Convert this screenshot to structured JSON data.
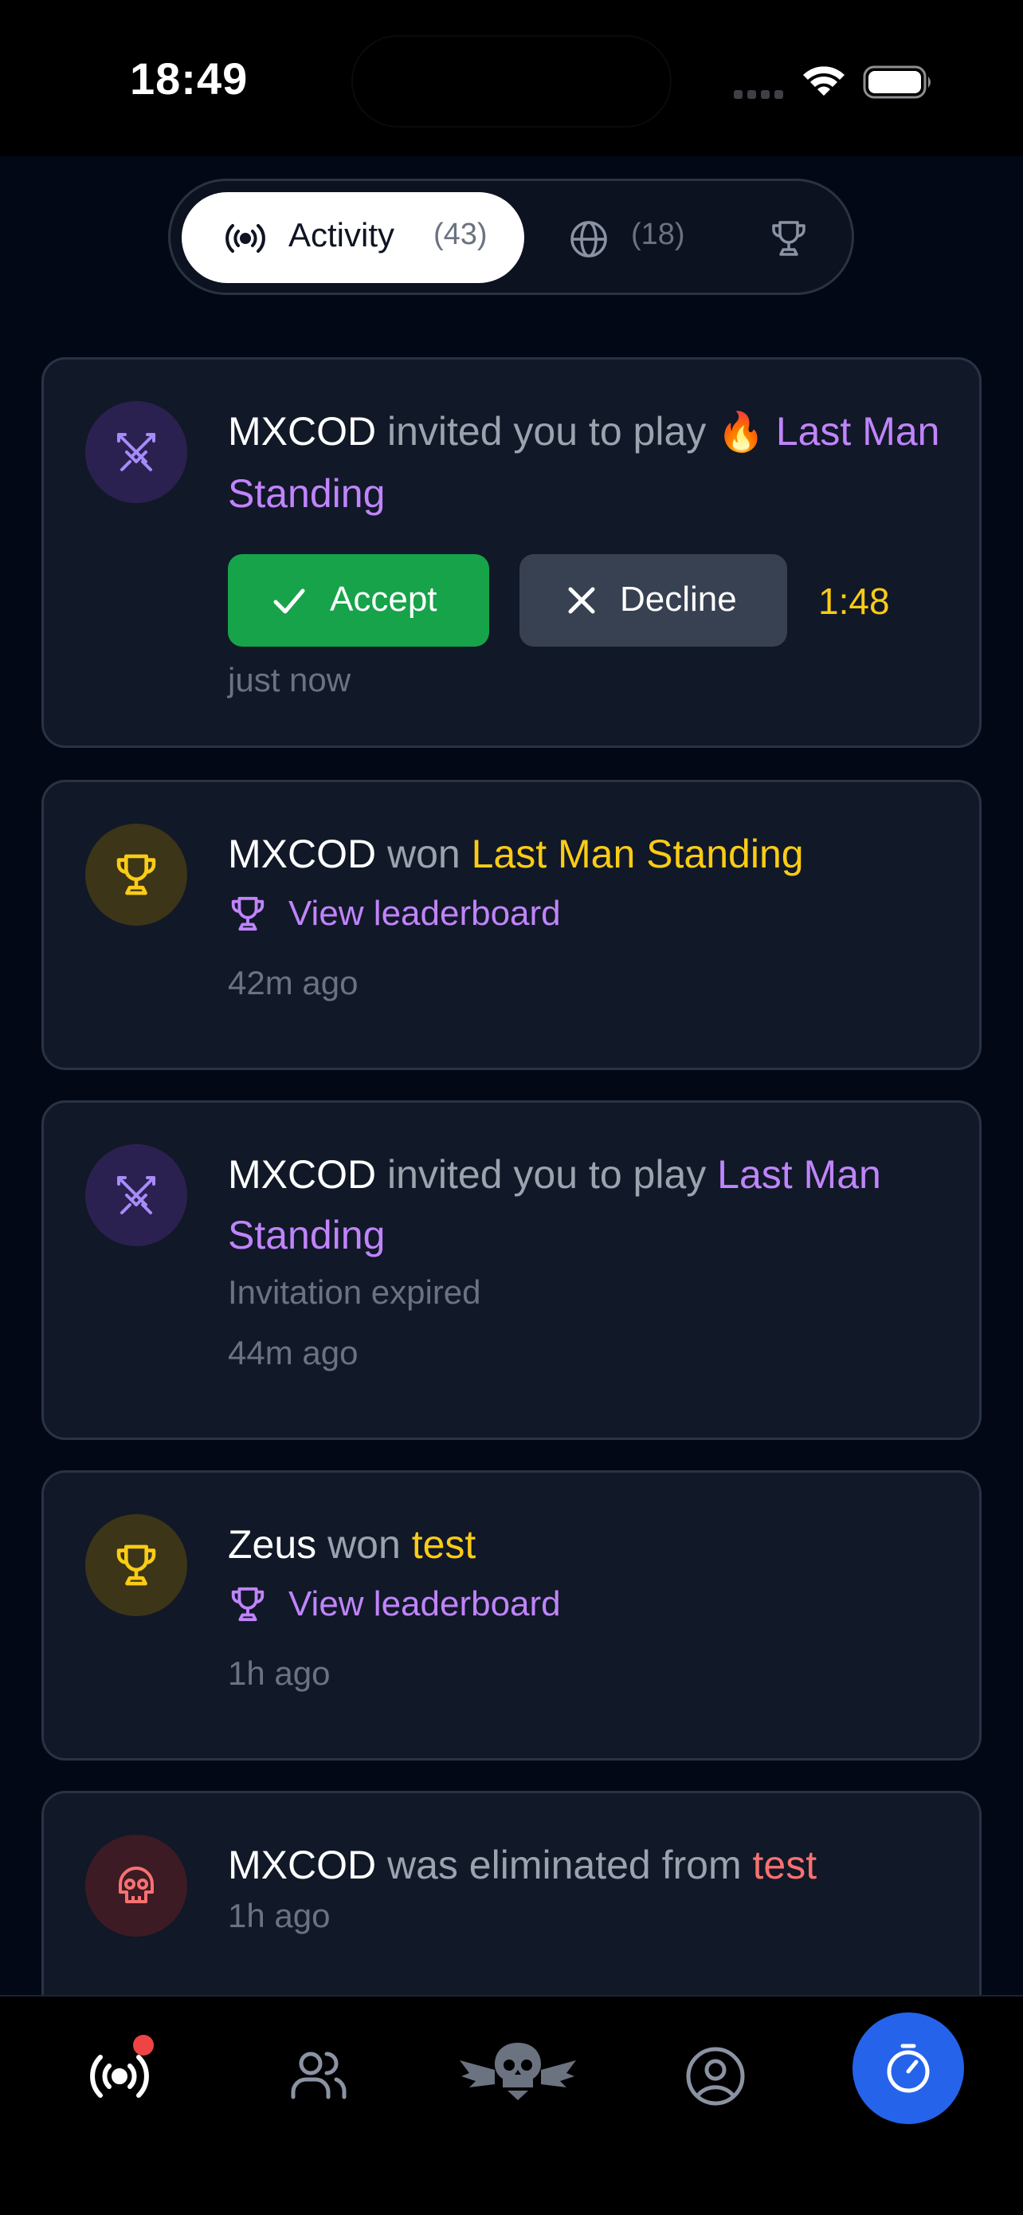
{
  "status": {
    "time": "18:49"
  },
  "tabs": {
    "activity_label": "Activity",
    "activity_count": "(43)",
    "global_count": "(18)"
  },
  "feed": [
    {
      "type": "invite",
      "name": "MXCOD",
      "text": " invited you to play ",
      "emoji": "🔥",
      "game": "Last Man Standing",
      "accept_label": "Accept",
      "decline_label": "Decline",
      "countdown": "1:48",
      "time": "just now",
      "icon": "swords-icon"
    },
    {
      "type": "win",
      "name": "MXCOD",
      "text": " won ",
      "game": "Last Man Standing",
      "link": "View leaderboard",
      "time": "42m ago",
      "icon": "trophy-icon"
    },
    {
      "type": "invite-expired",
      "name": "MXCOD",
      "text": " invited you to play ",
      "game": "Last Man Standing",
      "status": "Invitation expired",
      "time": "44m ago",
      "icon": "swords-icon"
    },
    {
      "type": "win",
      "name": "Zeus",
      "text": " won ",
      "game": "test",
      "link": "View leaderboard",
      "time": "1h ago",
      "icon": "trophy-icon"
    },
    {
      "type": "eliminated",
      "name": "MXCOD",
      "text": " was eliminated from ",
      "game": "test",
      "time": "1h ago",
      "icon": "skull-icon"
    }
  ],
  "bottom_nav": [
    "activity",
    "friends",
    "games",
    "profile",
    "timer"
  ],
  "colors": {
    "background": "#030816",
    "card": "#111827",
    "accent_purple": "#c084fc",
    "accent_yellow": "#facc15",
    "accent_red": "#f87171",
    "accept_green": "#16a34a",
    "fab_blue": "#2563eb"
  }
}
